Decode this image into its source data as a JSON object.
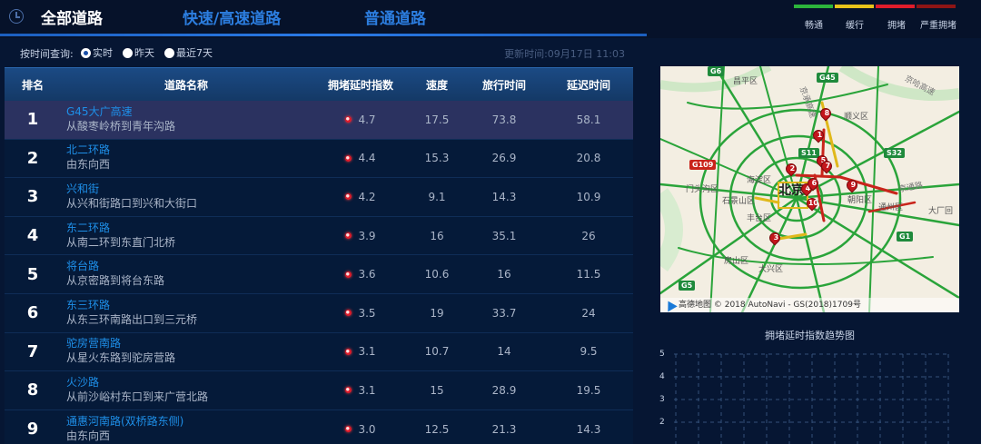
{
  "header": {
    "tabs": [
      {
        "label": "全部道路",
        "active": true
      },
      {
        "label": "快速/高速道路",
        "active": false
      },
      {
        "label": "普通道路",
        "active": false
      }
    ],
    "legend": [
      {
        "label": "畅通",
        "color": "#2cb53c"
      },
      {
        "label": "缓行",
        "color": "#e8c31a"
      },
      {
        "label": "拥堵",
        "color": "#e01c2b"
      },
      {
        "label": "严重拥堵",
        "color": "#8e1515"
      }
    ]
  },
  "query": {
    "label": "按时间查询:",
    "options": [
      {
        "label": "实时",
        "selected": true
      },
      {
        "label": "昨天",
        "selected": false
      },
      {
        "label": "最近7天",
        "selected": false
      }
    ],
    "update_time": "更新时间:09月17日 11:03"
  },
  "table": {
    "headers": [
      "排名",
      "道路名称",
      "拥堵延时指数",
      "速度",
      "旅行时间",
      "延迟时间"
    ],
    "rows": [
      {
        "rank": "1",
        "name": "G45大广高速",
        "desc": "从酸枣岭桥到青年沟路",
        "index": "4.7",
        "speed": "17.5",
        "travel": "73.8",
        "delay": "58.1"
      },
      {
        "rank": "2",
        "name": "北二环路",
        "desc": "由东向西",
        "index": "4.4",
        "speed": "15.3",
        "travel": "26.9",
        "delay": "20.8"
      },
      {
        "rank": "3",
        "name": "兴和街",
        "desc": "从兴和街路口到兴和大街口",
        "index": "4.2",
        "speed": "9.1",
        "travel": "14.3",
        "delay": "10.9"
      },
      {
        "rank": "4",
        "name": "东二环路",
        "desc": "从南二环到东直门北桥",
        "index": "3.9",
        "speed": "16",
        "travel": "35.1",
        "delay": "26"
      },
      {
        "rank": "5",
        "name": "将台路",
        "desc": "从京密路到将台东路",
        "index": "3.6",
        "speed": "10.6",
        "travel": "16",
        "delay": "11.5"
      },
      {
        "rank": "6",
        "name": "东三环路",
        "desc": "从东三环南路出口到三元桥",
        "index": "3.5",
        "speed": "19",
        "travel": "33.7",
        "delay": "24"
      },
      {
        "rank": "7",
        "name": "驼房营南路",
        "desc": "从星火东路到驼房营路",
        "index": "3.1",
        "speed": "10.7",
        "travel": "14",
        "delay": "9.5"
      },
      {
        "rank": "8",
        "name": "火沙路",
        "desc": "从前沙峪村东口到来广营北路",
        "index": "3.1",
        "speed": "15",
        "travel": "28.9",
        "delay": "19.5"
      },
      {
        "rank": "9",
        "name": "通惠河南路(双桥路东侧)",
        "desc": "由东向西",
        "index": "3.0",
        "speed": "12.5",
        "travel": "21.3",
        "delay": "14.3"
      }
    ]
  },
  "map": {
    "city": "北京",
    "districts": [
      "昌平区",
      "顺义区",
      "海淀区",
      "门头沟区",
      "石景山区",
      "丰台区",
      "朝阳区",
      "通州区",
      "房山区",
      "大兴区",
      "大厂回"
    ],
    "roads_visible": [
      "京哈高速",
      "京承高速",
      "京通路"
    ],
    "shields": [
      {
        "label": "G6",
        "kind": "g"
      },
      {
        "label": "G45",
        "kind": "g"
      },
      {
        "label": "S11",
        "kind": "g"
      },
      {
        "label": "S32",
        "kind": "g"
      },
      {
        "label": "G109",
        "kind": "r"
      },
      {
        "label": "G1",
        "kind": "g"
      },
      {
        "label": "G5",
        "kind": "g"
      }
    ],
    "pins": [
      "8",
      "1",
      "5",
      "7",
      "2",
      "4",
      "6",
      "9",
      "10",
      "3"
    ],
    "footer": "高德地图 © 2018 AutoNavi - GS(2018)1709号"
  },
  "trend": {
    "title": "拥堵延时指数趋势图",
    "y_ticks": [
      "5",
      "4",
      "3",
      "2"
    ]
  }
}
